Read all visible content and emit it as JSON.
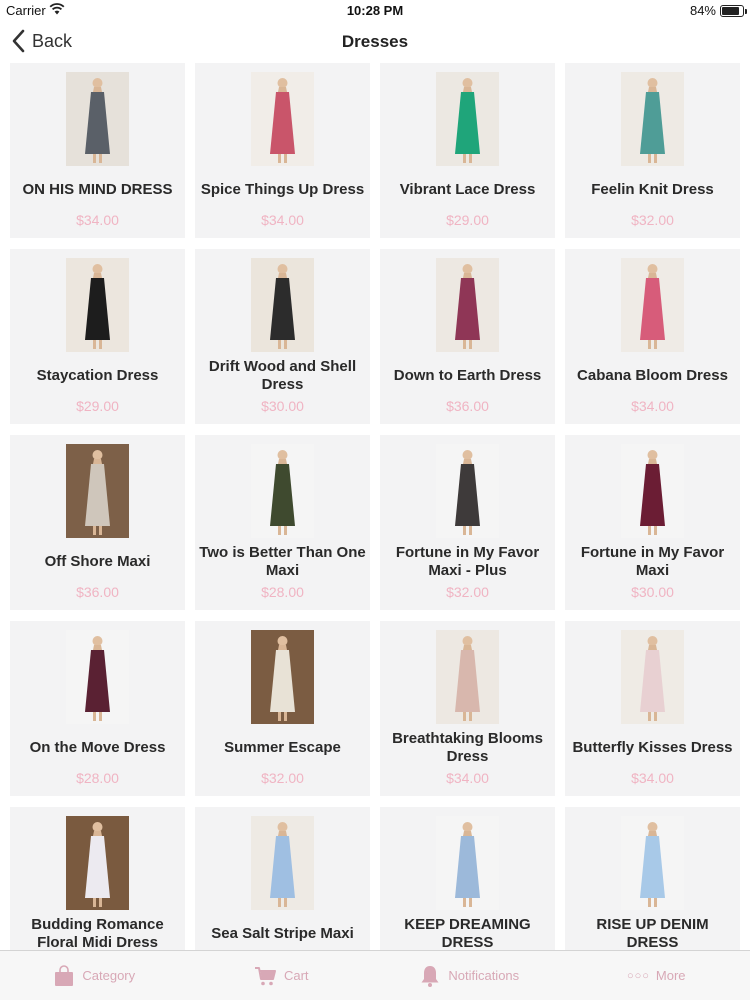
{
  "status": {
    "carrier": "Carrier",
    "time": "10:28 PM",
    "battery": "84%"
  },
  "nav": {
    "back_label": "Back",
    "title": "Dresses"
  },
  "products": [
    {
      "name": "ON HIS MIND DRESS",
      "price": "$34.00",
      "bg": "#e6e1da",
      "dress": "#5a6068"
    },
    {
      "name": "Spice Things Up Dress",
      "price": "$34.00",
      "bg": "#f1ede8",
      "dress": "#c9556a"
    },
    {
      "name": "Vibrant Lace Dress",
      "price": "$29.00",
      "bg": "#ece8e2",
      "dress": "#1fa57a"
    },
    {
      "name": "Feelin Knit Dress",
      "price": "$32.00",
      "bg": "#eeeae4",
      "dress": "#4f9d97"
    },
    {
      "name": "Staycation Dress",
      "price": "$29.00",
      "bg": "#ece6de",
      "dress": "#1d1d1d"
    },
    {
      "name": "Drift Wood and Shell Dress",
      "price": "$30.00",
      "bg": "#ebe5dc",
      "dress": "#2c2c2c"
    },
    {
      "name": "Down to Earth Dress",
      "price": "$36.00",
      "bg": "#ede8e2",
      "dress": "#8f3656"
    },
    {
      "name": "Cabana Bloom Dress",
      "price": "$34.00",
      "bg": "#efebe6",
      "dress": "#d75c7a"
    },
    {
      "name": "Off Shore Maxi",
      "price": "$36.00",
      "bg": "#7d6048",
      "dress": "#cfc6bb"
    },
    {
      "name": "Two is Better Than One Maxi",
      "price": "$28.00",
      "bg": "#f5f5f5",
      "dress": "#3f4a2f"
    },
    {
      "name": "Fortune in My Favor Maxi - Plus",
      "price": "$32.00",
      "bg": "#f5f5f5",
      "dress": "#3e3a3a"
    },
    {
      "name": "Fortune in My Favor Maxi",
      "price": "$30.00",
      "bg": "#f5f5f5",
      "dress": "#6b1d34"
    },
    {
      "name": "On the Move Dress",
      "price": "$28.00",
      "bg": "#f5f5f5",
      "dress": "#5a2133"
    },
    {
      "name": "Summer Escape",
      "price": "$32.00",
      "bg": "#7b5c42",
      "dress": "#e8e2d6"
    },
    {
      "name": "Breathtaking Blooms Dress",
      "price": "$34.00",
      "bg": "#ede8e2",
      "dress": "#d8b7ad"
    },
    {
      "name": "Butterfly Kisses Dress",
      "price": "$34.00",
      "bg": "#efebe5",
      "dress": "#e8d0d2"
    },
    {
      "name": "Budding Romance Floral Midi Dress",
      "price": "",
      "bg": "#7a5a3f",
      "dress": "#eceaf0"
    },
    {
      "name": "Sea Salt Stripe Maxi",
      "price": "",
      "bg": "#eeeae4",
      "dress": "#9fbfe2"
    },
    {
      "name": "KEEP DREAMING DRESS",
      "price": "",
      "bg": "#f5f5f5",
      "dress": "#9cb9da"
    },
    {
      "name": "RISE UP DENIM DRESS",
      "price": "",
      "bg": "#f5f5f5",
      "dress": "#a8c9e8"
    }
  ],
  "tabs": [
    {
      "label": "Category",
      "icon": "shopping-bag-icon"
    },
    {
      "label": "Cart",
      "icon": "cart-icon"
    },
    {
      "label": "Notifications",
      "icon": "bell-icon"
    },
    {
      "label": "More",
      "icon": "more-dots-icon"
    }
  ],
  "colors": {
    "price": "#f0b4c3",
    "tab_inactive": "#d8a8b6",
    "card_bg": "#f3f3f4"
  }
}
